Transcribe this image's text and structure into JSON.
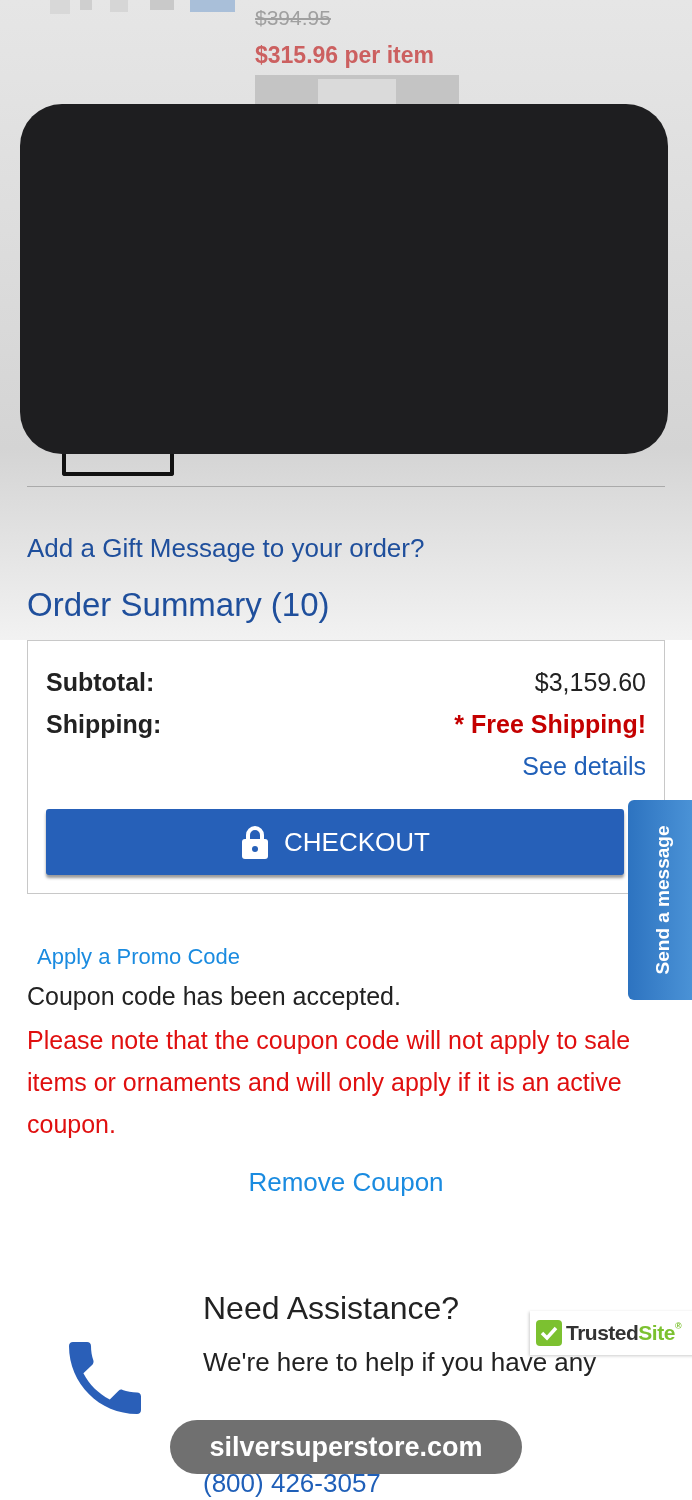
{
  "product": {
    "kind": "picture",
    "old_price": "$394.95",
    "price": "$315.96 per item"
  },
  "gift_link": "Add a Gift Message to your order?",
  "order_summary": {
    "title": "Order Summary (10)",
    "rows": [
      {
        "label": "Subtotal:",
        "value": "$3,159.60",
        "kind": "plain"
      },
      {
        "label": "Shipping:",
        "value": "* Free Shipping!",
        "kind": "alert"
      }
    ],
    "details_link": "See details",
    "checkout_button": "CHECKOUT"
  },
  "message_tab": "Send a message",
  "promo": {
    "link": "Apply a Promo Code",
    "status": "Coupon code has been accepted.",
    "note": "Please note that the coupon code will not apply to sale items or ornaments and will only apply if it is an active coupon.",
    "remove": "Remove Coupon"
  },
  "assistance": {
    "title": "Need Assistance?",
    "text": "We're here to help if you have any",
    "phone": "(800) 426-3057"
  },
  "badge": {
    "brand": "Trusted",
    "suffix": "Site",
    "mark": "®"
  },
  "address_bar": "silversuperstore.com"
}
